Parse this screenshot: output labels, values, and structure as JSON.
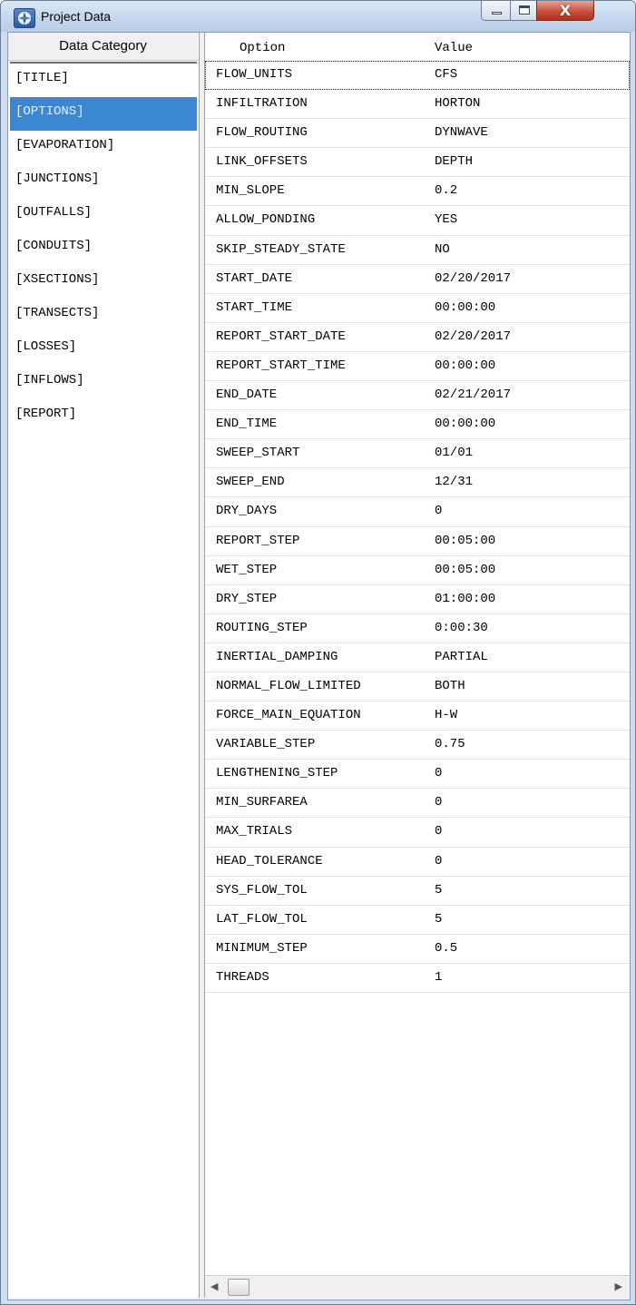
{
  "window": {
    "title": "Project Data",
    "close_glyph": "X"
  },
  "category_panel": {
    "header": "Data Category",
    "items": [
      "[TITLE]",
      "[OPTIONS]",
      "[EVAPORATION]",
      "[JUNCTIONS]",
      "[OUTFALLS]",
      "[CONDUITS]",
      "[XSECTIONS]",
      "[TRANSECTS]",
      "[LOSSES]",
      "[INFLOWS]",
      "[REPORT]"
    ],
    "selected": "[OPTIONS]"
  },
  "grid": {
    "columns": [
      "Option",
      "Value"
    ],
    "rows": [
      {
        "option": "FLOW_UNITS",
        "value": "CFS"
      },
      {
        "option": "INFILTRATION",
        "value": "HORTON"
      },
      {
        "option": "FLOW_ROUTING",
        "value": "DYNWAVE"
      },
      {
        "option": "LINK_OFFSETS",
        "value": "DEPTH"
      },
      {
        "option": "MIN_SLOPE",
        "value": "0.2"
      },
      {
        "option": "ALLOW_PONDING",
        "value": "YES"
      },
      {
        "option": "SKIP_STEADY_STATE",
        "value": "NO"
      },
      {
        "option": "START_DATE",
        "value": "02/20/2017"
      },
      {
        "option": "START_TIME",
        "value": "00:00:00"
      },
      {
        "option": "REPORT_START_DATE",
        "value": "02/20/2017"
      },
      {
        "option": "REPORT_START_TIME",
        "value": "00:00:00"
      },
      {
        "option": "END_DATE",
        "value": "02/21/2017"
      },
      {
        "option": "END_TIME",
        "value": "00:00:00"
      },
      {
        "option": "SWEEP_START",
        "value": "01/01"
      },
      {
        "option": "SWEEP_END",
        "value": "12/31"
      },
      {
        "option": "DRY_DAYS",
        "value": "0"
      },
      {
        "option": "REPORT_STEP",
        "value": "00:05:00"
      },
      {
        "option": "WET_STEP",
        "value": "00:05:00"
      },
      {
        "option": "DRY_STEP",
        "value": "01:00:00"
      },
      {
        "option": "ROUTING_STEP",
        "value": "0:00:30"
      },
      {
        "option": "INERTIAL_DAMPING",
        "value": "PARTIAL"
      },
      {
        "option": "NORMAL_FLOW_LIMITED",
        "value": "BOTH"
      },
      {
        "option": "FORCE_MAIN_EQUATION",
        "value": "H-W"
      },
      {
        "option": "VARIABLE_STEP",
        "value": "0.75"
      },
      {
        "option": "LENGTHENING_STEP",
        "value": "0"
      },
      {
        "option": "MIN_SURFAREA",
        "value": "0"
      },
      {
        "option": "MAX_TRIALS",
        "value": "0"
      },
      {
        "option": "HEAD_TOLERANCE",
        "value": "0"
      },
      {
        "option": "SYS_FLOW_TOL",
        "value": "5"
      },
      {
        "option": "LAT_FLOW_TOL",
        "value": "5"
      },
      {
        "option": "MINIMUM_STEP",
        "value": "0.5"
      },
      {
        "option": "THREADS",
        "value": "1"
      }
    ]
  },
  "icons": {
    "app": "project-data-app-icon",
    "minimize": "minimize-icon",
    "maximize": "maximize-icon",
    "close": "close-icon",
    "scroll_left": "scroll-left-arrow-icon",
    "scroll_right": "scroll-right-arrow-icon"
  },
  "colors": {
    "selection": "#3b87d2",
    "close_button": "#c8513b"
  }
}
